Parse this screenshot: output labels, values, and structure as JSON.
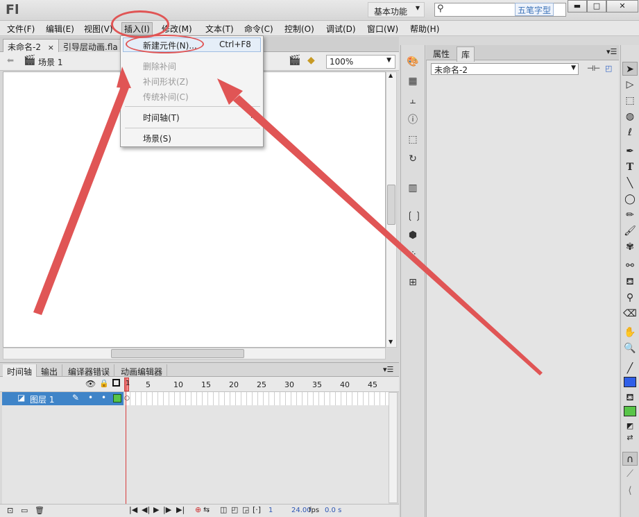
{
  "app": {
    "logo": "Fl",
    "workspace": "基本功能",
    "search_placeholder": "",
    "ime_label": "五笔字型"
  },
  "window_buttons": {
    "minimize": "▬",
    "maximize": "□",
    "close": "✕"
  },
  "menubar": [
    "文件(F)",
    "编辑(E)",
    "视图(V)",
    "插入(I)",
    "修改(M)",
    "文本(T)",
    "命令(C)",
    "控制(O)",
    "调试(D)",
    "窗口(W)",
    "帮助(H)"
  ],
  "doc_tabs": [
    {
      "label": "未命名-2",
      "close": "×"
    },
    {
      "label": "引导层动画.fla"
    }
  ],
  "scene": {
    "label": "场景 1",
    "zoom": "100%"
  },
  "insert_menu": {
    "new_symbol": {
      "label": "新建元件(N)...",
      "shortcut": "Ctrl+F8"
    },
    "remove_tween": "删除补间",
    "shape_tween": "补间形状(Z)",
    "classic_tween": "传统补间(C)",
    "timeline": "时间轴(T)",
    "scene": "场景(S)"
  },
  "timeline": {
    "tabs": [
      "时间轴",
      "输出",
      "编译器错误",
      "动画编辑器"
    ],
    "frame_numbers": [
      "1",
      "5",
      "10",
      "15",
      "20",
      "25",
      "30",
      "35",
      "40",
      "45"
    ],
    "layer_name": "图层 1",
    "current_frame": "1",
    "fps": "24.00",
    "fps_unit": "fps",
    "time": "0.0 s"
  },
  "library_panel": {
    "tabs": [
      "属性",
      "库"
    ],
    "document": "未命名-2"
  },
  "colors": {
    "annotation": "#e05555",
    "layer_highlight": "#3f84c8",
    "fill": "#2f5fe8",
    "fill2": "#58c548"
  }
}
